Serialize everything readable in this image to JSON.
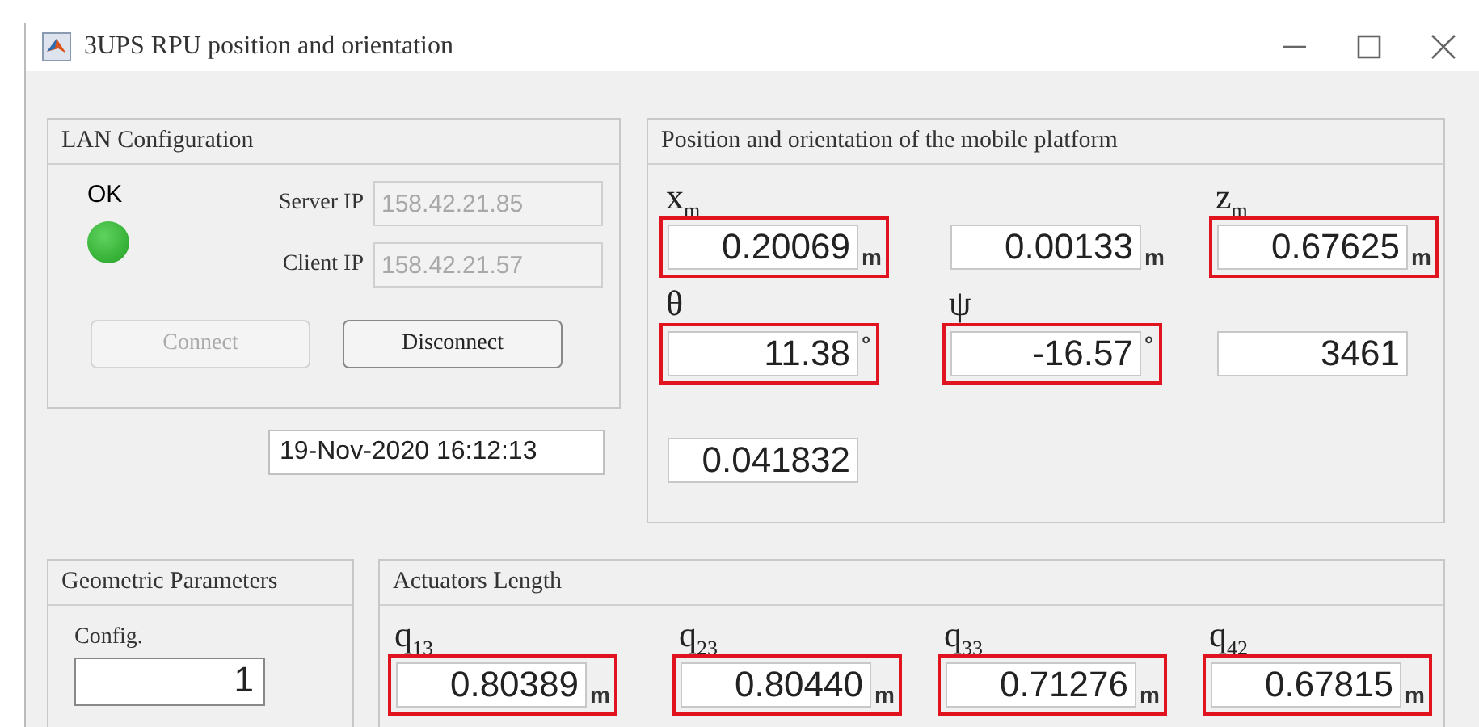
{
  "window": {
    "title": "3UPS RPU position and orientation"
  },
  "lan": {
    "title": "LAN Configuration",
    "status": "OK",
    "led_on": true,
    "fields": [
      {
        "label": "Server IP",
        "value": "158.42.21.85",
        "disabled": true
      },
      {
        "label": "Client IP",
        "value": "158.42.21.57",
        "disabled": true
      }
    ],
    "buttons": [
      {
        "label": "Connect",
        "disabled": true
      },
      {
        "label": "Disconnect",
        "disabled": false
      }
    ]
  },
  "timestamp": "19-Nov-2020 16:12:13",
  "position": {
    "title": "Position and orientation of the mobile platform",
    "fields": [
      {
        "label": "x$_{m}$",
        "value": "0.20069",
        "unit": "m",
        "highlighted": true
      },
      {
        "value": "0.00133",
        "unit": "m",
        "highlighted": false
      },
      {
        "label": "z$_{m}$",
        "value": "0.67625",
        "unit": "m",
        "highlighted": true
      },
      {
        "label": "θ",
        "value": "11.38",
        "unit": "°",
        "highlighted": true
      },
      {
        "label": "ψ",
        "value": "-16.57",
        "unit": "°",
        "highlighted": true
      },
      {
        "value": "3461",
        "highlighted": false
      },
      {
        "value": "0.041832",
        "highlighted": false
      }
    ]
  },
  "geometric": {
    "title": "Geometric Parameters",
    "label": "Config.",
    "value": "1"
  },
  "actuators": {
    "title": "Actuators Length",
    "fields": [
      {
        "label": "q$_{13}$",
        "value": "0.80389",
        "unit": "m",
        "highlighted": true
      },
      {
        "label": "q$_{23}$",
        "value": "0.80440",
        "unit": "m",
        "highlighted": true
      },
      {
        "label": "q$_{33}$",
        "value": "0.71276",
        "unit": "m",
        "highlighted": true
      },
      {
        "label": "q$_{42}$",
        "value": "0.67815",
        "unit": "m",
        "highlighted": true
      }
    ]
  }
}
